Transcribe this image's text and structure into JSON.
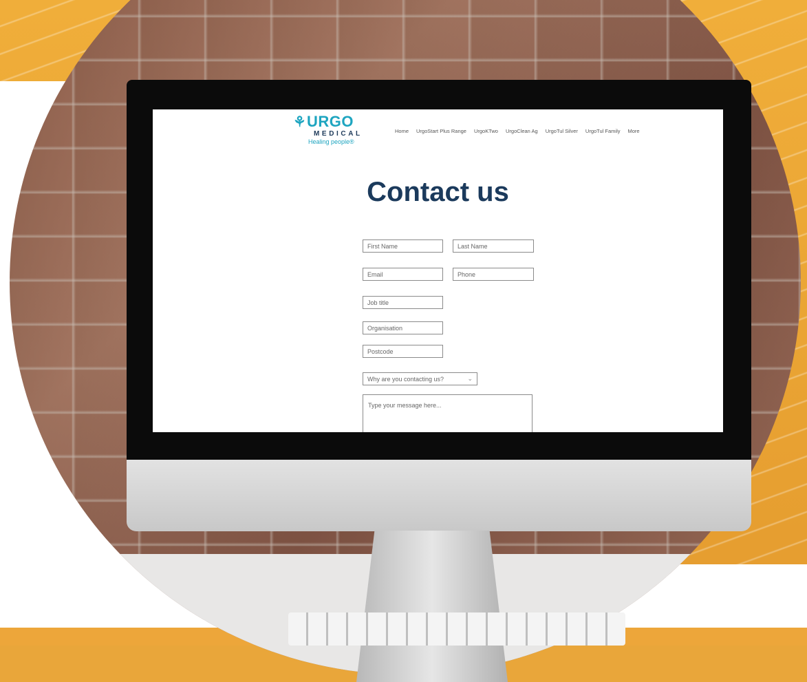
{
  "brand": {
    "logo_mark": "⚘",
    "logo_word": "URGO",
    "logo_medical": "MEDICAL",
    "logo_tagline": "Healing people®",
    "colors": {
      "teal": "#1ea5c0",
      "navy": "#1b3a5c",
      "orange": "#eda63a"
    }
  },
  "nav": {
    "items": [
      "Home",
      "UrgoStart Plus Range",
      "UrgoKTwo",
      "UrgoClean Ag",
      "UrgoTul Silver",
      "UrgoTul Family",
      "More"
    ]
  },
  "page": {
    "title": "Contact us"
  },
  "form": {
    "first_name_placeholder": "First Name",
    "last_name_placeholder": "Last Name",
    "email_placeholder": "Email",
    "phone_placeholder": "Phone",
    "job_title_placeholder": "Job title",
    "organisation_placeholder": "Organisation",
    "postcode_placeholder": "Postcode",
    "reason_placeholder": "Why are you contacting us?",
    "message_placeholder": "Type your message here..."
  },
  "icons": {
    "dropdown": "chevron-down-icon"
  }
}
